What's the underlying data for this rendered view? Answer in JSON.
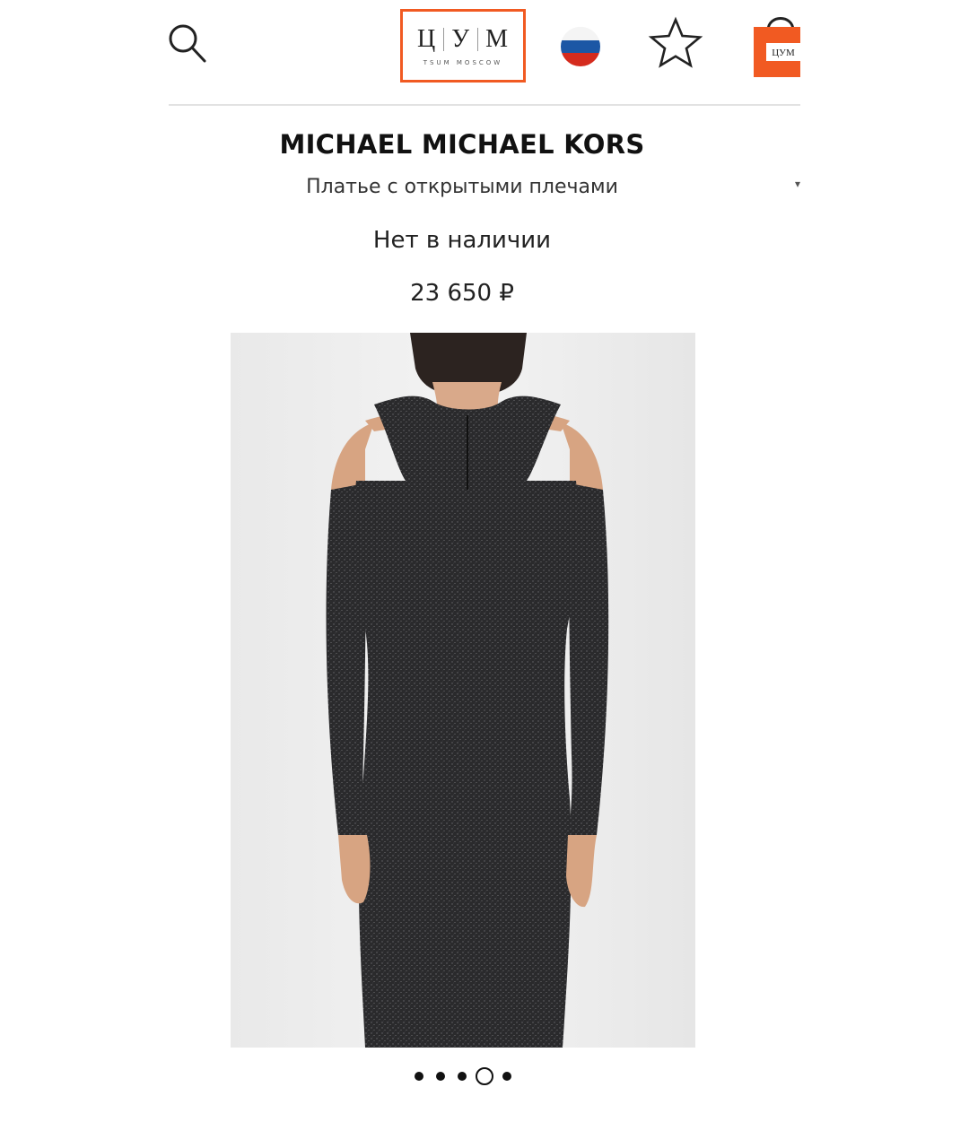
{
  "header": {
    "logo": {
      "letters": [
        "Ц",
        "У",
        "М"
      ],
      "subtitle": "TSUM MOSCOW",
      "accent": "#f15a22"
    },
    "icons": {
      "search": "search-icon",
      "region": "russia-flag-icon",
      "favorites": "star-icon",
      "cart": "shopping-bag-icon"
    },
    "flag_colors": [
      "#ffffff",
      "#1c57a5",
      "#d52b1e"
    ]
  },
  "product": {
    "brand": "MICHAEL MICHAEL KORS",
    "name": "Платье с открытыми плечами",
    "availability": "Нет в наличии",
    "price": "23 650 ₽"
  },
  "gallery": {
    "total_images": 5,
    "active_index": 3
  }
}
